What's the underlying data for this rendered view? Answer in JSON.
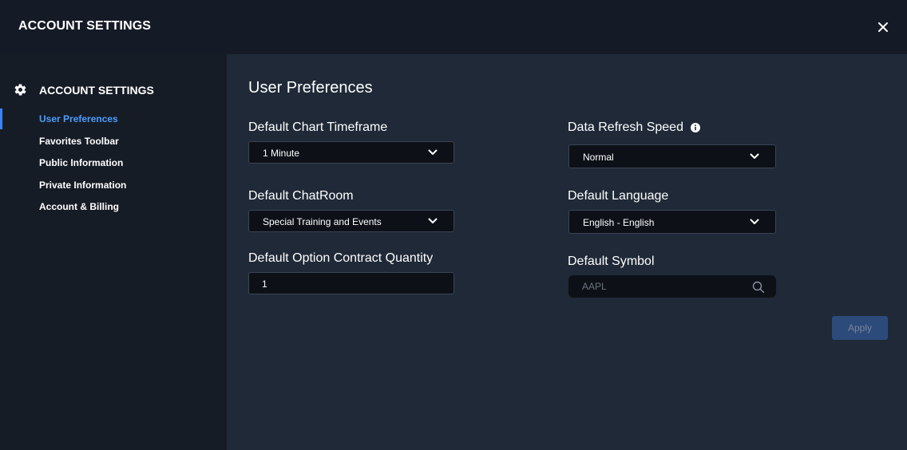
{
  "header": {
    "title": "ACCOUNT SETTINGS"
  },
  "sidebar": {
    "heading": "ACCOUNT SETTINGS",
    "items": [
      {
        "label": "User Preferences",
        "active": true
      },
      {
        "label": "Favorites Toolbar",
        "active": false
      },
      {
        "label": "Public Information",
        "active": false
      },
      {
        "label": "Private Information",
        "active": false
      },
      {
        "label": "Account & Billing",
        "active": false
      }
    ]
  },
  "main": {
    "title": "User Preferences",
    "chart_timeframe": {
      "label": "Default Chart Timeframe",
      "value": "1 Minute"
    },
    "chatroom": {
      "label": "Default ChatRoom",
      "value": "Special Training and Events"
    },
    "option_quantity": {
      "label": "Default Option Contract Quantity",
      "value": "1"
    },
    "refresh_speed": {
      "label": "Data Refresh Speed",
      "value": "Normal"
    },
    "language": {
      "label": "Default Language",
      "value": "English - English"
    },
    "symbol": {
      "label": "Default Symbol",
      "placeholder": "AAPL"
    },
    "apply_label": "Apply"
  },
  "colors": {
    "accent": "#4a9eff",
    "header_bg": "#151b26",
    "sidebar_bg": "#161c26",
    "content_bg": "#1f2937",
    "apply_bg": "#2c4a7a"
  },
  "icons": {
    "close": "close-icon",
    "gear": "gear-icon",
    "info": "info-icon",
    "chevron": "chevron-down-icon",
    "search": "search-icon"
  }
}
